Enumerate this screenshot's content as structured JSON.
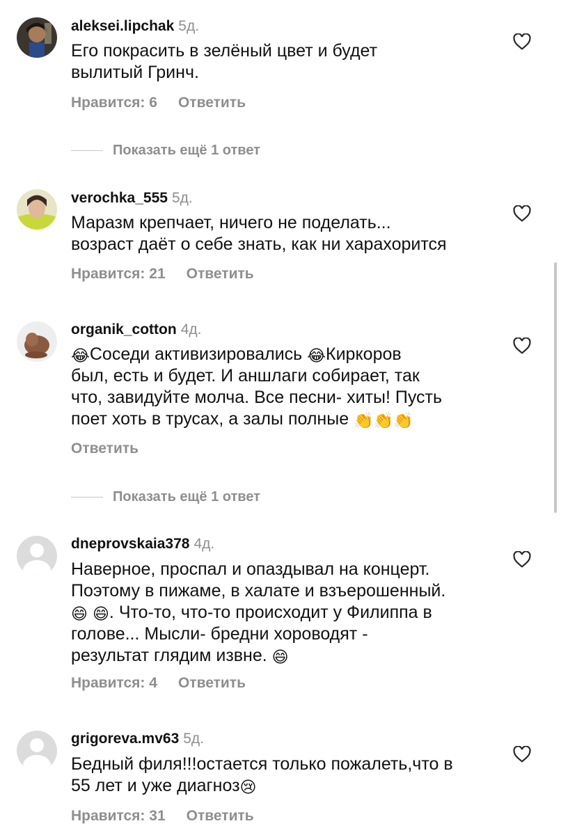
{
  "comments": [
    {
      "username": "aleksei.lipchak",
      "time": "5д.",
      "text_lines": [
        "Его покрасить в зелёный цвет и будет",
        "вылитый Гринч."
      ],
      "likes": "Нравится: 6",
      "reply": "Ответить",
      "more_replies": "Показать ещё 1 ответ",
      "avatar": "dark-portrait-avatar"
    },
    {
      "username": "verochka_555",
      "time": "5д.",
      "text_lines": [
        "Маразм крепчает, ничего не поделать...",
        "возраст даёт о себе знать, как ни харахорится"
      ],
      "likes": "Нравится: 21",
      "reply": "Ответить",
      "avatar": "girl-photo-avatar"
    },
    {
      "username": "organik_cotton",
      "time": "4д.",
      "text_parts": [
        "Соседи активизировались ",
        "Киркоров",
        "был, есть и будет. И аншлаги собирает, так",
        "что, завидуйте молча. Все песни- хиты! Пусть",
        "поет хоть в трусах, а залы полные "
      ],
      "reply": "Ответить",
      "more_replies": "Показать ещё 1 ответ",
      "avatar": "dog-photo-avatar"
    },
    {
      "username": "dneprovskaia378",
      "time": "4д.",
      "text_parts": [
        "Наверное, проспал и опаздывал на концерт.",
        "Поэтому в пижаме, в халате и взъерошенный.",
        ". Что-то, что-то происходит у Филиппа в",
        "голове... Мысли- бредни хороводят -",
        "результат глядим извне. "
      ],
      "likes": "Нравится: 4",
      "reply": "Ответить",
      "avatar": "default-avatar"
    },
    {
      "username": "grigoreva.mv63",
      "time": "5д.",
      "text_parts": [
        "Бедный филя!!!остается только пожалеть,что в",
        "55 лет и уже диагноз"
      ],
      "likes": "Нравится: 31",
      "reply": "Ответить",
      "avatar": "default-avatar"
    }
  ],
  "emoji": {
    "laugh_tears": "😂",
    "clap": "👏",
    "grin": "😄",
    "cry": "😢"
  },
  "icons": [
    "heart-outline-icon"
  ],
  "colors": {
    "text": "#111111",
    "muted": "#8e8e8e",
    "divider": "#c7c7c7"
  }
}
